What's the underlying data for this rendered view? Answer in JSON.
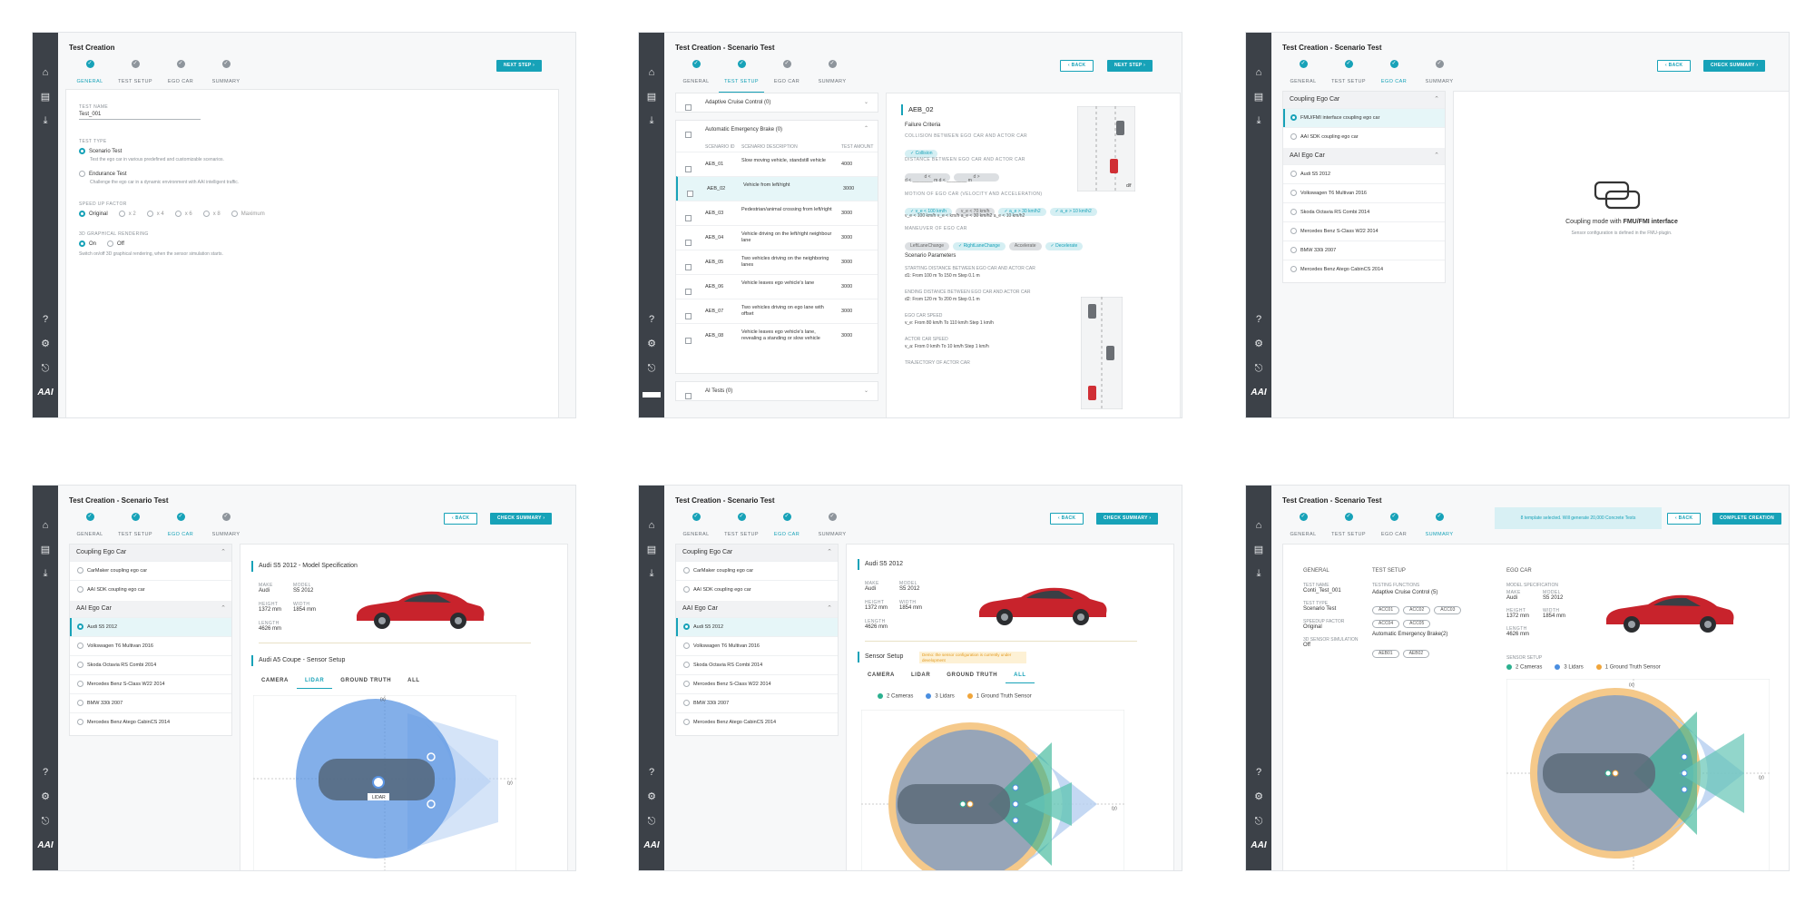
{
  "app": {
    "title": "Test Creation",
    "subtitle": "Scenario Test",
    "steps": [
      "GENERAL",
      "TEST SETUP",
      "EGO CAR",
      "SUMMARY"
    ],
    "logo": "AAI"
  },
  "buttons": {
    "next_step": "NEXT STEP",
    "back": "BACK",
    "check_summary": "CHECK SUMMARY",
    "complete_creation": "COMPLETE CREATION"
  },
  "general": {
    "test_name_label": "TEST NAME",
    "test_name_value": "Test_001",
    "test_type_label": "TEST TYPE",
    "scenario_title": "Scenario Test",
    "scenario_desc": "Test the ego car in various predefined and customizable scenarios.",
    "endurance_title": "Endurance Test",
    "endurance_desc": "Challenge the ego car in a dynamic environment with AAI intelligent traffic.",
    "speed_label": "SPEED UP FACTOR",
    "speed_options": [
      "Original",
      "x 2",
      "x 4",
      "x 6",
      "x 8",
      "Maximum"
    ],
    "render_label": "3D GRAPHICAL RENDERING",
    "render_on": "On",
    "render_off": "Off",
    "render_desc": "Switch on/off 3D graphical rendering, when the sensor simulation starts."
  },
  "test_setup": {
    "acc_group": "Adaptive Cruise Control (0)",
    "aeb_group": "Automatic Emergency Brake (0)",
    "ai_group": "AI Tests (0)",
    "col_id": "SCENARIO ID",
    "col_desc": "SCENARIO DESCRIPTION",
    "col_amount": "TEST AMOUNT",
    "rows": [
      {
        "id": "AEB_01",
        "desc": "Slow moving vehicle, standstill vehicle",
        "amount": "4000"
      },
      {
        "id": "AEB_02",
        "desc": "Vehicle from left/right",
        "amount": "3000"
      },
      {
        "id": "AEB_03",
        "desc": "Pedestrian/animal crossing from left/right",
        "amount": "3000"
      },
      {
        "id": "AEB_04",
        "desc": "Vehicle driving on the left/right neighbour lane",
        "amount": "3000"
      },
      {
        "id": "AEB_05",
        "desc": "Two vehicles driving on the neighboring lanes",
        "amount": "3000"
      },
      {
        "id": "AEB_06",
        "desc": "Vehicle leaves ego vehicle's lane",
        "amount": "3000"
      },
      {
        "id": "AEB_07",
        "desc": "Two vehicles driving on ego lane with offset",
        "amount": "3000"
      },
      {
        "id": "AEB_08",
        "desc": "Vehicle leaves ego vehicle's lane, revealing a standing or slow vehicle",
        "amount": "3000"
      }
    ],
    "detail_title": "AEB_02",
    "failure_criteria": "Failure Criteria",
    "collision_label": "COLLISION BETWEEN EGO CAR AND ACTOR CAR",
    "collision_chip": "✓ Collision",
    "distance_label": "DISTANCE BETWEEN EGO CAR AND ACTOR CAR",
    "motion_label": "MOTION OF EGO CAR (VELOCITY AND ACCELERATION)",
    "motion_chips": [
      "✓ v_e < 100 km/h",
      "v_e < 70 km/h",
      "✓ a_e > 30 km/h2",
      "✓ a_e > 10 km/h2"
    ],
    "motion_values": "v_e < 100 km/h   v_e <        km/h   a_e < 30 km/h2   a_e < 10 km/h2",
    "maneuver_label": "MANEUVER OF EGO CAR",
    "maneuver_chips": [
      "LeftLaneChange",
      "✓ RightLaneChange",
      "Accelerate",
      "✓ Decelerate"
    ],
    "params_title": "Scenario Parameters",
    "param1_label": "STARTING DISTANCE BETWEEN EGO CAR AND ACTOR CAR",
    "param1_values": "d1: From 100 m   To 150 m   Step 0.1 m",
    "param2_label": "ENDING DISTANCE BETWEEN EGO CAR AND ACTOR CAR",
    "param2_values": "d2: From 120 m   To 200 m   Step 0.1 m",
    "param3_label": "EGO CAR SPEED",
    "param3_values": "v_e: From 80 km/h   To 110 km/h   Step 1 km/h",
    "param4_label": "ACTOR CAR SPEED",
    "param4_values": "v_a: From 0 km/h   To 10 km/h   Step 1 km/h",
    "param5_label": "TRAJECTORY OF ACTOR CAR"
  },
  "ego": {
    "coupling_group": "Coupling Ego Car",
    "coupling_fmu": "FMU/FMI interface coupling ego car",
    "coupling_aai": "AAI SDK coupling ego car",
    "coupling_carmaker": "CarMaker coupling ego car",
    "aai_group": "AAI Ego Car",
    "cars": [
      "Audi S5 2012",
      "Volkswagen T6 Multivan 2016",
      "Skoda Octavia RS Combi 2014",
      "Mercedes Benz S-Class W22 2014",
      "BMW 330i 2007",
      "Mercedes Benz Atego CabinCS 2014"
    ],
    "fmu_title_pre": "Coupling mode with",
    "fmu_title_bold": "FMU/FMI interface",
    "fmu_desc": "Sensor configuration is defined in the FMU-plugin.",
    "model_spec_title": "Audi S5 2012 - Model Specification",
    "model_title": "Audi S5 2012",
    "make_label": "MAKE",
    "make": "Audi",
    "model_label": "MODEL",
    "model": "S5 2012",
    "height_label": "HEIGHT",
    "height": "1372 mm",
    "width_label": "WIDTH",
    "width": "1854 mm",
    "length_label": "LENGTH",
    "length": "4626 mm",
    "sensor_setup_title": "Audi A5 Coupe - Sensor Setup",
    "sensor_setup": "Sensor Setup",
    "sensor_warning": "Demo: the sensor configuration is currently under development",
    "sensor_tabs": [
      "CAMERA",
      "LIDAR",
      "GROUND TRUTH",
      "ALL"
    ],
    "legend_cameras": "2 Cameras",
    "legend_lidars": "3 Lidars",
    "legend_gt": "1 Ground Truth Sensor",
    "lidar_tag": "LIDAR",
    "axis_x": "(x)",
    "axis_y": "(y)"
  },
  "summary": {
    "banner": "8 template selected. Will generate 20,000 Concrete Tests",
    "general_hd": "GENERAL",
    "test_setup_hd": "TEST SETUP",
    "ego_hd": "EGO CAR",
    "test_name_label": "TEST NAME",
    "test_name": "Conti_Test_001",
    "test_type_label": "TEST TYPE",
    "test_type": "Scenario Test",
    "speed_label": "SPEEDUP FACTOR",
    "speed": "Original",
    "render_label": "3D SENSOR SIMULATION",
    "render": "Off",
    "testing_functions": "TESTING FUNCTIONS",
    "acc_title": "Adaptive Cruise Control (5)",
    "acc_chips": [
      "ACC01",
      "ACC02",
      "ACC03",
      "ACC04",
      "ACC05"
    ],
    "aeb_title": "Automatic Emergency Brake(2)",
    "aeb_chips": [
      "AEB01",
      "AEB02"
    ],
    "model_spec_label": "MODEL SPECIFICATION",
    "sensor_setup_label": "SENSOR SETUP"
  },
  "colors": {
    "accent": "#17a2b8",
    "sidebar": "#3c4148",
    "camera": "#2bb08f",
    "lidar": "#4a8ee0",
    "ground_truth": "#f0a53a",
    "car_red": "#c8232c"
  }
}
